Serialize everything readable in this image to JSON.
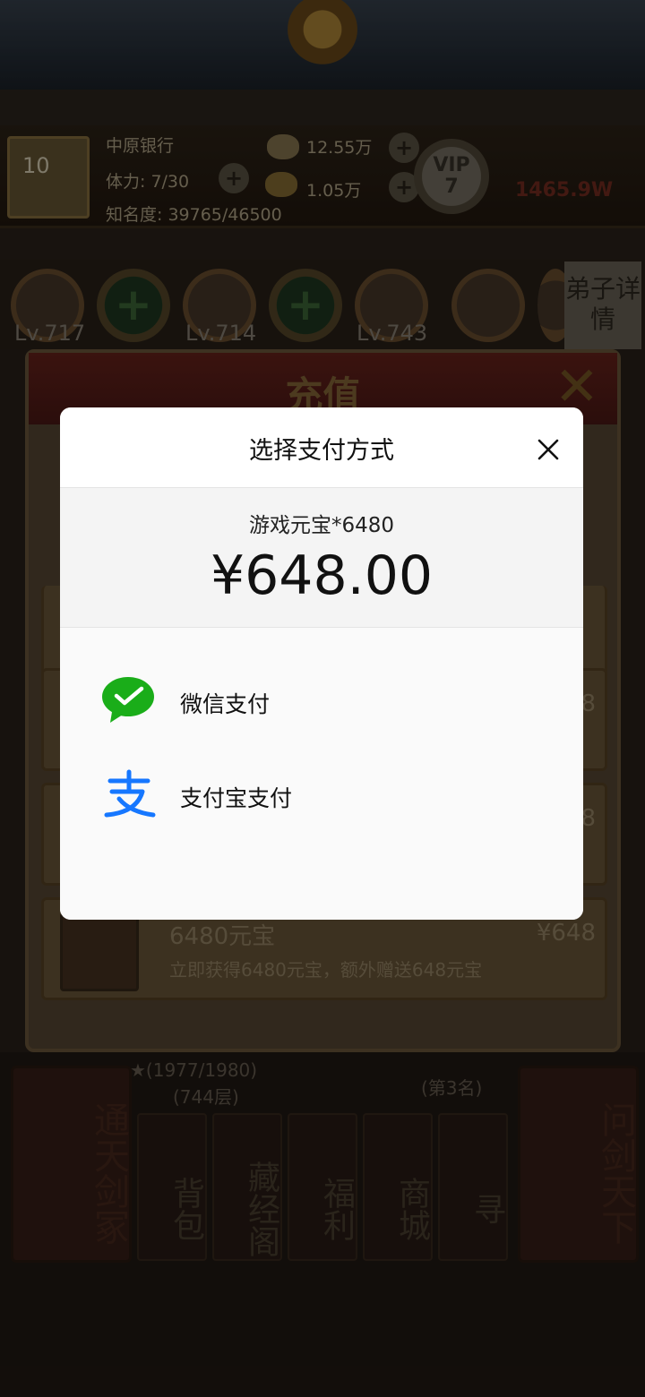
{
  "game": {
    "avatar_level": "10",
    "bank_name": "中原银行",
    "stamina": "体力: 7/30",
    "fame": "知名度: 39765/46500",
    "silver": "12.55万",
    "gold": "1.05万",
    "vip_label": "VIP",
    "vip_level": "7",
    "power": "1465.9W",
    "disciples": [
      {
        "level": "Lv.717"
      },
      {
        "level": "Lv.714"
      },
      {
        "level": "Lv.743"
      }
    ],
    "detail_tab": "弟子详情",
    "recharge_title": "充值",
    "recharge_items": [
      {
        "name": "6480元宝",
        "price": "¥648",
        "desc": "立即获得6480元宝，额外赠送648元宝"
      }
    ],
    "partial_prices": [
      "8",
      "8"
    ],
    "rank_stars": "★(1977/1980)",
    "rank_floor": "(744层)",
    "rank_place": "(第3名)",
    "big_tabs": [
      "通天剑冢",
      "问剑天下"
    ],
    "small_tabs": [
      "背包",
      "藏经阁",
      "福利",
      "商城",
      "寻"
    ]
  },
  "dialog": {
    "title": "选择支付方式",
    "product": "游戏元宝*6480",
    "price": "¥648.00",
    "options": [
      {
        "label": "微信支付",
        "icon": "wechat-pay-icon",
        "color": "#1aad19"
      },
      {
        "label": "支付宝支付",
        "icon": "alipay-icon",
        "color": "#1677ff"
      }
    ]
  }
}
